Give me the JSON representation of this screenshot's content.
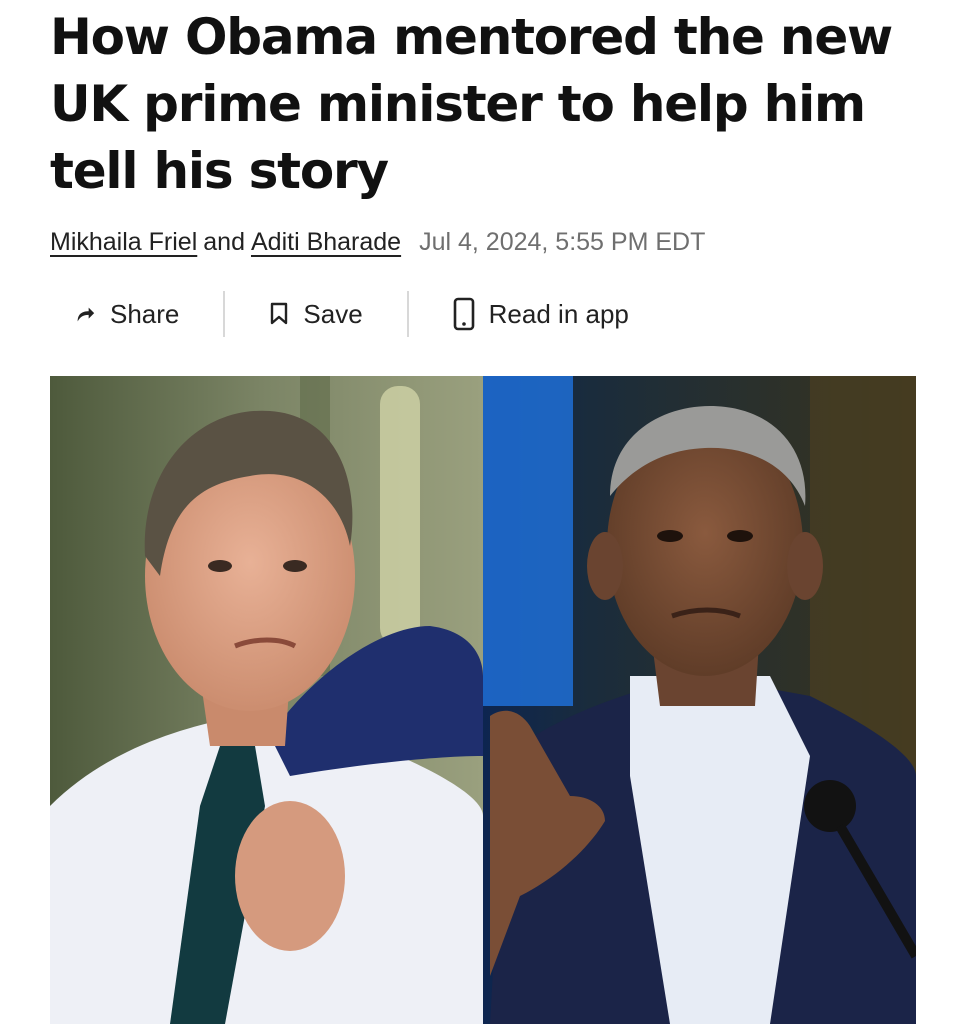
{
  "article": {
    "headline": "How Obama mentored the new UK prime minister to help him tell his story",
    "authors": [
      "Mikhaila Friel",
      "Aditi Bharade"
    ],
    "author_separator": "and",
    "date": "Jul 4, 2024, 5:55 PM EDT"
  },
  "actions": {
    "share_label": "Share",
    "save_label": "Save",
    "read_in_app_label": "Read in app"
  },
  "icons": {
    "share": "share-arrow-icon",
    "save": "bookmark-icon",
    "read_in_app": "phone-icon"
  },
  "image": {
    "description_colors": {
      "left_background": "#6f7a55",
      "right_background": "#2b2a1c",
      "blue_light": "#1f6fd6"
    }
  }
}
